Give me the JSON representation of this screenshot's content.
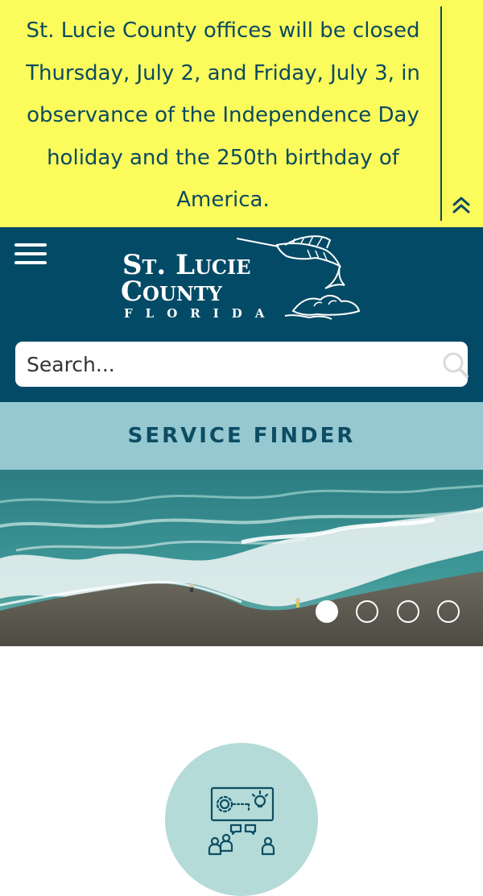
{
  "alert": {
    "message": "St. Lucie County offices will be closed Thursday, July 2, and Friday, July 3, in observance of the Independence Day holiday and the 250th birthday of America.",
    "toggle_icon": "chevron-double-up-icon",
    "background_color": "#fbfb5c",
    "text_color": "#0b4b61"
  },
  "header": {
    "menu_icon": "hamburger-menu-icon",
    "logo": {
      "line1": "St. Lucie",
      "line2": "County",
      "line3": "FLORIDA"
    },
    "background_color": "#034a66"
  },
  "search": {
    "placeholder": "Search...",
    "icon": "search-icon"
  },
  "service_finder": {
    "label": "SERVICE FINDER",
    "background_color": "#95c8d1"
  },
  "hero": {
    "slides_total": 4,
    "active_slide": 1
  },
  "feature": {
    "icon": "community-engagement-icon",
    "circle_color": "#b4dbd8"
  }
}
